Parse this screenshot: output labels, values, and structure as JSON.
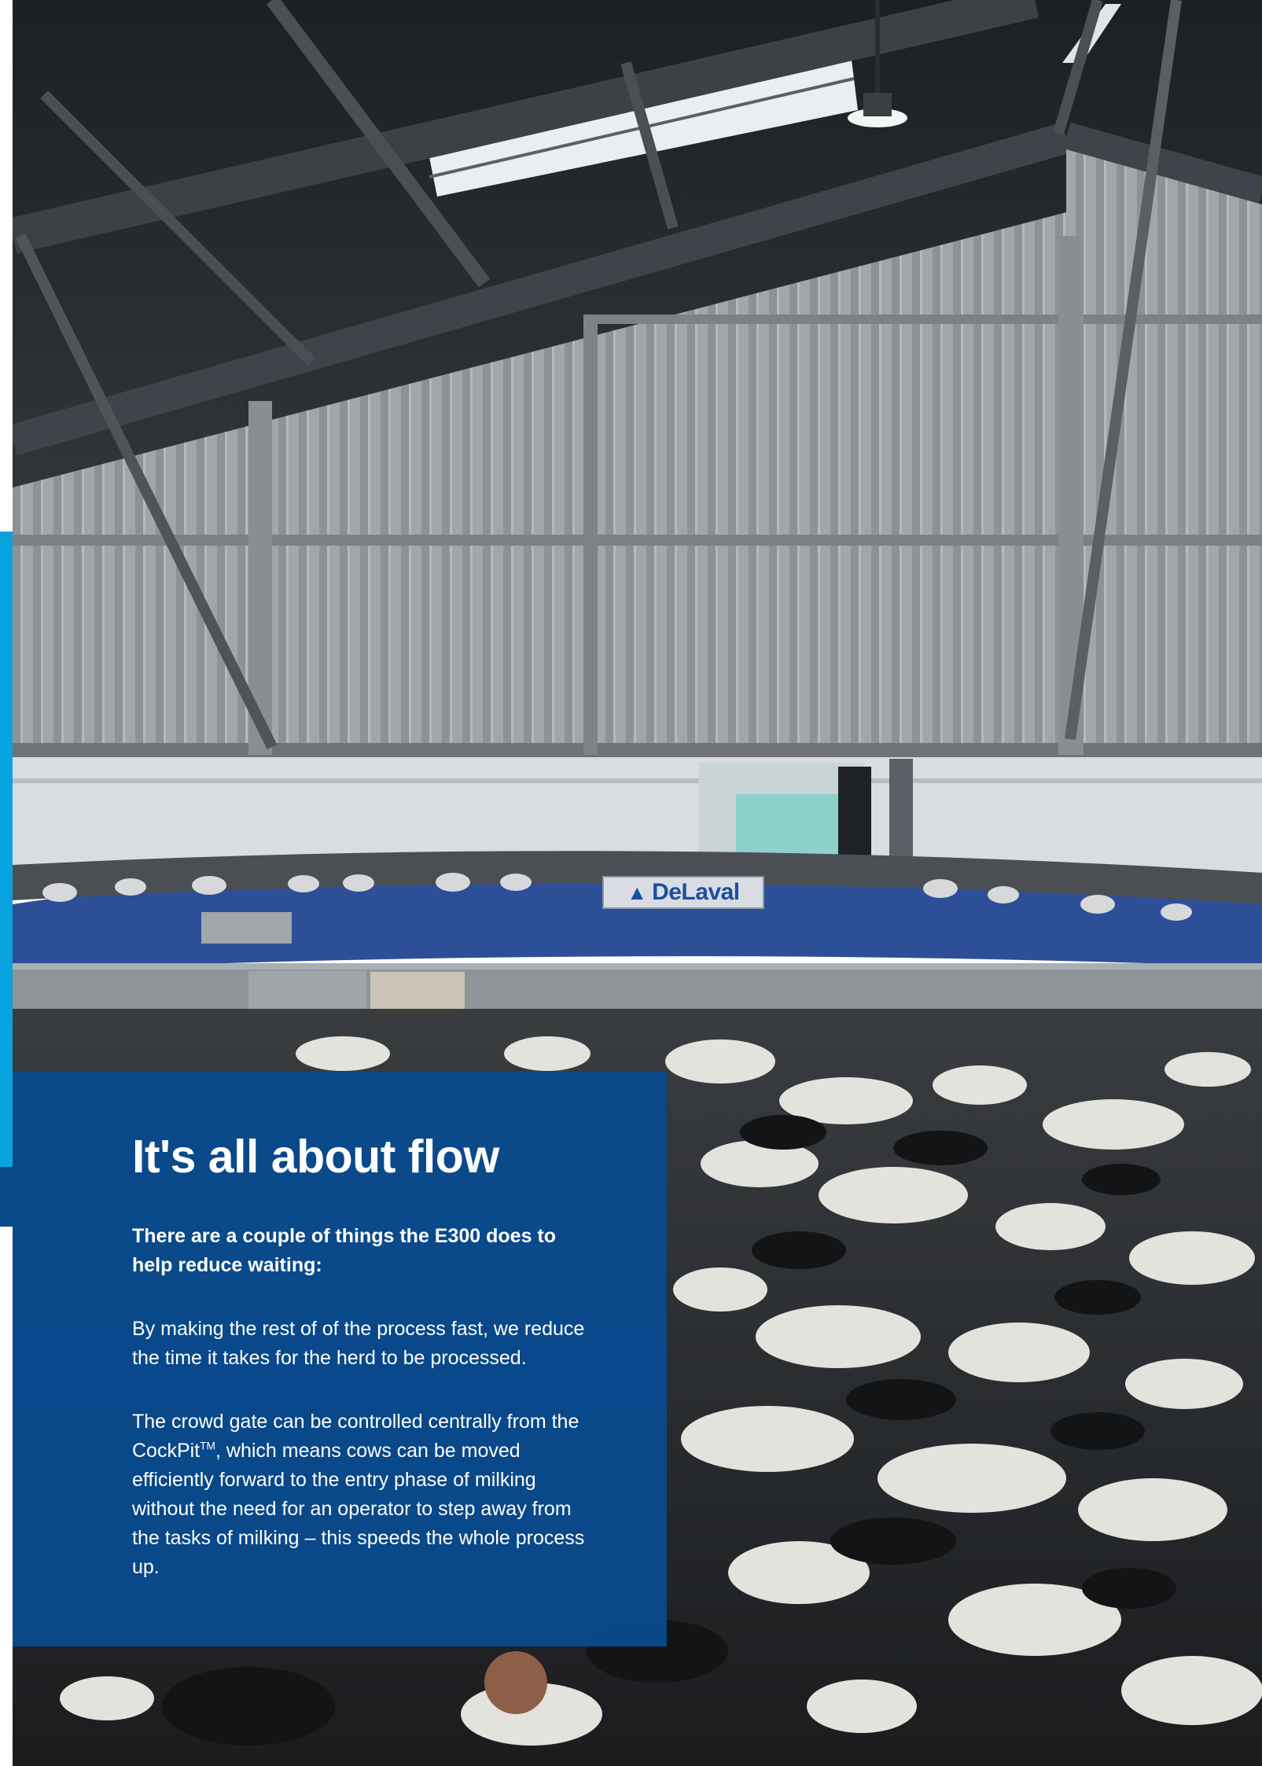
{
  "panel": {
    "heading": "It's all about flow",
    "lead": "There are a couple of things the E300 does to help reduce waiting:",
    "para1": "By making the rest of of the process fast, we reduce the time it takes for the herd to be processed.",
    "para2_part1": "The crowd gate can be controlled centrally from the CockPit",
    "para2_tm": "TM",
    "para2_part2": ", which means cows can be moved efficiently forward to the entry phase of milking without the need for an operator to step away from the tasks of milking – this speeds the whole process up."
  },
  "photo": {
    "logo_text": "DeLaval"
  },
  "colors": {
    "panel_blue": "#084a8e",
    "edge_cyan": "#0aa3e0",
    "edge_navy": "#0a4a8a"
  }
}
